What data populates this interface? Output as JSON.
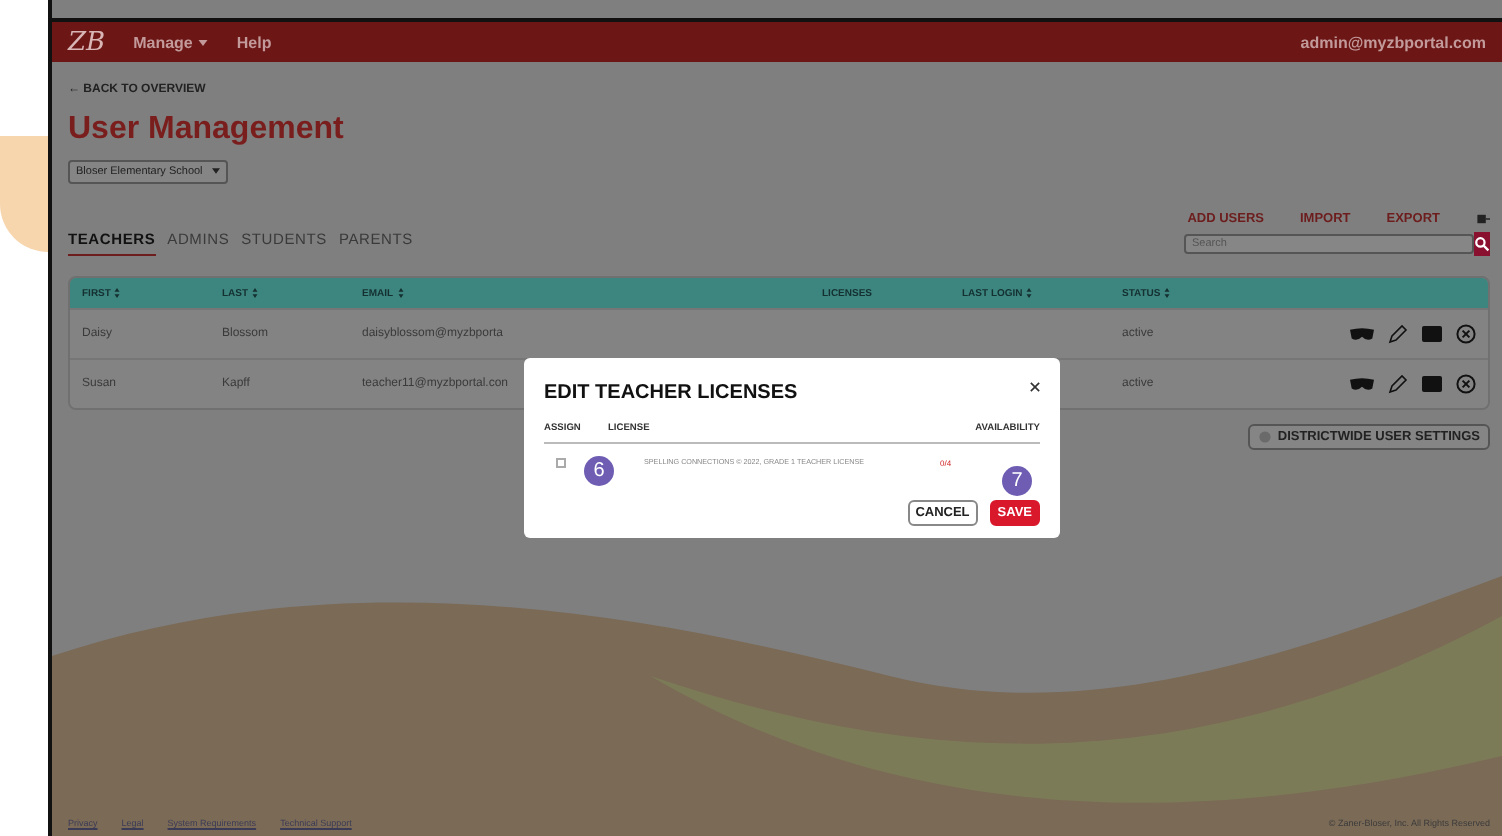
{
  "navbar": {
    "logo": "ZB",
    "menu": [
      {
        "label": "Manage",
        "dropdown": true
      },
      {
        "label": "Help",
        "dropdown": false
      }
    ],
    "user": "admin@myzbportal.com"
  },
  "back_link": "← BACK TO OVERVIEW",
  "title": "User Management",
  "school_select": {
    "value": "Bloser Elementary School"
  },
  "actions": [
    "ADD USERS",
    "IMPORT",
    "EXPORT"
  ],
  "search": {
    "placeholder": "Search"
  },
  "tabs": [
    {
      "label": "TEACHERS",
      "selected": true
    },
    {
      "label": "ADMINS",
      "selected": false
    },
    {
      "label": "STUDENTS",
      "selected": false
    },
    {
      "label": "PARENTS",
      "selected": false
    }
  ],
  "table": {
    "columns": [
      {
        "label": "FIRST",
        "sortable": true
      },
      {
        "label": "LAST",
        "sortable": true
      },
      {
        "label": "EMAIL",
        "sortable": true
      },
      {
        "label": "LICENSES",
        "sortable": false
      },
      {
        "label": "LAST LOGIN",
        "sortable": true
      },
      {
        "label": "STATUS",
        "sortable": true
      }
    ],
    "rows": [
      {
        "cells": [
          "Daisy",
          "Blossom",
          "daisyblossom@myzbporta",
          "",
          "",
          "active"
        ]
      },
      {
        "cells": [
          "Susan",
          "Kapff",
          "teacher11@myzbportal.con",
          "",
          "",
          "active"
        ]
      }
    ]
  },
  "districtwide_button": "DISTRICTWIDE USER SETTINGS",
  "modal": {
    "title": "EDIT TEACHER LICENSES",
    "columns": [
      "ASSIGN",
      "LICENSE",
      "AVAILABILITY"
    ],
    "rows": [
      {
        "checked": false,
        "license": "SPELLING CONNECTIONS © 2022, GRADE 1 TEACHER LICENSE",
        "availability": "0/4"
      }
    ],
    "buttons": [
      {
        "label": "CANCEL",
        "kind": "secondary"
      },
      {
        "label": "SAVE",
        "kind": "primary"
      }
    ]
  },
  "callouts": [
    {
      "label": "6"
    },
    {
      "label": "7"
    }
  ],
  "footer": {
    "links": [
      "Privacy",
      "Legal",
      "System Requirements",
      "Technical Support"
    ],
    "copyright": "© Zaner-Bloser, Inc. All Rights Reserved"
  }
}
